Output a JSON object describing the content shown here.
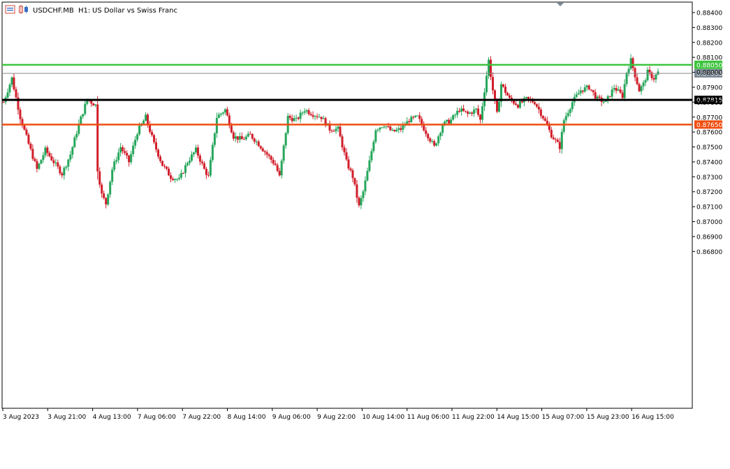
{
  "header": {
    "symbol": "USDCHF.MB",
    "timeframe": "H1:",
    "description": "US Dollar vs Swiss Franc"
  },
  "colors": {
    "bull": "#26a65b",
    "bear": "#d11e2a",
    "resistance": "#3cc43c",
    "pivot": "#000000",
    "support": "#f04e10",
    "bid": "#888888",
    "bid_tag": "#7a8894"
  },
  "chart_data": {
    "type": "candlestick",
    "ylim": [
      0.8575,
      0.8847
    ],
    "y_ticks": [
      "0.88400",
      "0.88300",
      "0.88200",
      "0.88100",
      "0.88000",
      "0.87900",
      "0.87800",
      "0.87700",
      "0.87600",
      "0.87500",
      "0.87400",
      "0.87300",
      "0.87200",
      "0.87100",
      "0.87000",
      "0.86900",
      "0.86800"
    ],
    "x_labels": [
      "3 Aug 2023",
      "3 Aug 21:00",
      "4 Aug 13:00",
      "7 Aug 06:00",
      "7 Aug 22:00",
      "8 Aug 14:00",
      "9 Aug 06:00",
      "9 Aug 22:00",
      "10 Aug 14:00",
      "11 Aug 06:00",
      "11 Aug 22:00",
      "14 Aug 15:00",
      "15 Aug 07:00",
      "15 Aug 23:00",
      "16 Aug 15:00"
    ],
    "h_lines": [
      {
        "value": 0.8805,
        "label": "0.88050",
        "color": "#3cc43c"
      },
      {
        "value": 0.87993,
        "label": "0.87993",
        "color": "#888888"
      },
      {
        "value": 0.87815,
        "label": "0.87815",
        "color": "#000000"
      },
      {
        "value": 0.8765,
        "label": "0.87650",
        "color": "#f04e10"
      }
    ],
    "keypoints": [
      [
        0,
        0.878
      ],
      [
        4,
        0.8796
      ],
      [
        8,
        0.877
      ],
      [
        12,
        0.8752
      ],
      [
        16,
        0.8735
      ],
      [
        20,
        0.8748
      ],
      [
        24,
        0.874
      ],
      [
        28,
        0.8732
      ],
      [
        32,
        0.8745
      ],
      [
        36,
        0.8765
      ],
      [
        40,
        0.8782
      ],
      [
        44,
        0.8778
      ],
      [
        45,
        0.8735
      ],
      [
        47,
        0.8718
      ],
      [
        49,
        0.8712
      ],
      [
        52,
        0.8735
      ],
      [
        56,
        0.875
      ],
      [
        60,
        0.874
      ],
      [
        64,
        0.876
      ],
      [
        68,
        0.877
      ],
      [
        72,
        0.8752
      ],
      [
        76,
        0.8738
      ],
      [
        80,
        0.873
      ],
      [
        84,
        0.8728
      ],
      [
        88,
        0.874
      ],
      [
        92,
        0.8748
      ],
      [
        96,
        0.8735
      ],
      [
        98,
        0.873
      ],
      [
        102,
        0.877
      ],
      [
        106,
        0.8775
      ],
      [
        110,
        0.8757
      ],
      [
        114,
        0.8755
      ],
      [
        118,
        0.8758
      ],
      [
        122,
        0.8752
      ],
      [
        126,
        0.8745
      ],
      [
        130,
        0.8738
      ],
      [
        132,
        0.873
      ],
      [
        136,
        0.877
      ],
      [
        140,
        0.8768
      ],
      [
        144,
        0.8775
      ],
      [
        148,
        0.8772
      ],
      [
        152,
        0.877
      ],
      [
        156,
        0.8762
      ],
      [
        160,
        0.8762
      ],
      [
        164,
        0.874
      ],
      [
        167,
        0.873
      ],
      [
        170,
        0.871
      ],
      [
        172,
        0.872
      ],
      [
        175,
        0.874
      ],
      [
        178,
        0.8762
      ],
      [
        182,
        0.8765
      ],
      [
        186,
        0.876
      ],
      [
        190,
        0.8762
      ],
      [
        194,
        0.8768
      ],
      [
        198,
        0.877
      ],
      [
        202,
        0.876
      ],
      [
        206,
        0.875
      ],
      [
        210,
        0.8765
      ],
      [
        214,
        0.8768
      ],
      [
        218,
        0.8775
      ],
      [
        222,
        0.8772
      ],
      [
        226,
        0.8775
      ],
      [
        228,
        0.8768
      ],
      [
        232,
        0.8808
      ],
      [
        234,
        0.8788
      ],
      [
        236,
        0.8772
      ],
      [
        238,
        0.8792
      ],
      [
        242,
        0.8782
      ],
      [
        246,
        0.8778
      ],
      [
        250,
        0.8782
      ],
      [
        254,
        0.878
      ],
      [
        258,
        0.877
      ],
      [
        262,
        0.8758
      ],
      [
        266,
        0.875
      ],
      [
        268,
        0.8768
      ],
      [
        272,
        0.878
      ],
      [
        276,
        0.8788
      ],
      [
        280,
        0.879
      ],
      [
        284,
        0.8782
      ],
      [
        288,
        0.878
      ],
      [
        292,
        0.879
      ],
      [
        296,
        0.8784
      ],
      [
        298,
        0.88
      ],
      [
        300,
        0.8808
      ],
      [
        302,
        0.8798
      ],
      [
        304,
        0.8788
      ],
      [
        306,
        0.8792
      ],
      [
        308,
        0.88
      ],
      [
        311,
        0.8796
      ],
      [
        313,
        0.88
      ]
    ]
  }
}
